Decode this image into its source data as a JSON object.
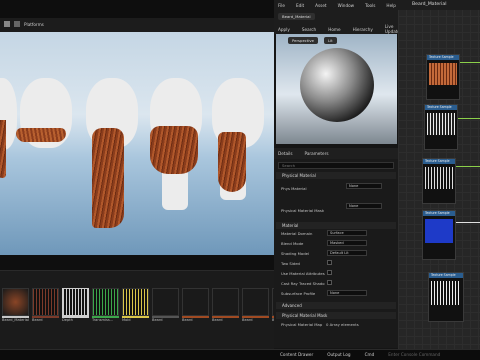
{
  "menu": {
    "items": [
      "File",
      "Edit",
      "Asset",
      "Window",
      "Tools",
      "Help"
    ]
  },
  "tab": {
    "title": "Beard_Material"
  },
  "viewport_toolbar": {
    "platforms_label": "Platforms"
  },
  "material_toolbar": {
    "items": [
      "Apply",
      "Search",
      "Home",
      "Hierarchy",
      "Live Update"
    ],
    "clean_label": "clean"
  },
  "preview": {
    "mode_label": "Perspective",
    "lit_label": "Lit"
  },
  "graph": {
    "title": "Beard_Material"
  },
  "details": {
    "tabs": [
      "Details",
      "Parameters"
    ],
    "search_placeholder": "Search",
    "physical_material": "Physical Material",
    "phys_mat_label": "Phys Material",
    "phys_mat_value": "None",
    "phys_mat_mask_label": "Physical Material Mask",
    "phys_mat_mask_value": "None",
    "material_section": "Material",
    "props": [
      {
        "label": "Material Domain",
        "value": "Surface"
      },
      {
        "label": "Blend Mode",
        "value": "Masked"
      },
      {
        "label": "Shading Model",
        "value": "Default Lit"
      },
      {
        "label": "Two Sided",
        "value": ""
      },
      {
        "label": "Use Material Attributes",
        "value": ""
      },
      {
        "label": "Cast Ray Traced Shado",
        "value": ""
      },
      {
        "label": "Subsurface Profile",
        "value": "None"
      }
    ],
    "advanced": "Advanced",
    "phys_mat_map_section": "Physical Material Mask",
    "phys_mat_map": "Physical Material Map",
    "phys_mat_map_value": "0 Array elements"
  },
  "content_browser": {
    "items": [
      {
        "label": "Beard_Material",
        "sub": "Material"
      },
      {
        "label": "Beard",
        "sub": ""
      },
      {
        "label": "Depth",
        "sub": ""
      },
      {
        "label": "Transmiss...",
        "sub": ""
      },
      {
        "label": "Mold",
        "sub": ""
      },
      {
        "label": "Beard",
        "sub": ""
      },
      {
        "label": "Beard",
        "sub": ""
      },
      {
        "label": "Beard",
        "sub": ""
      },
      {
        "label": "Beard",
        "sub": ""
      },
      {
        "label": "Beard",
        "sub": ""
      }
    ]
  },
  "status": {
    "content_drawer": "Content Drawer",
    "output_log": "Output Log",
    "cmd": "Cmd",
    "cmd_placeholder": "Enter Console Command"
  },
  "colors": {
    "accent": "#2a5d8f",
    "wire": "#8bd04a",
    "hair": "#a04a22"
  }
}
